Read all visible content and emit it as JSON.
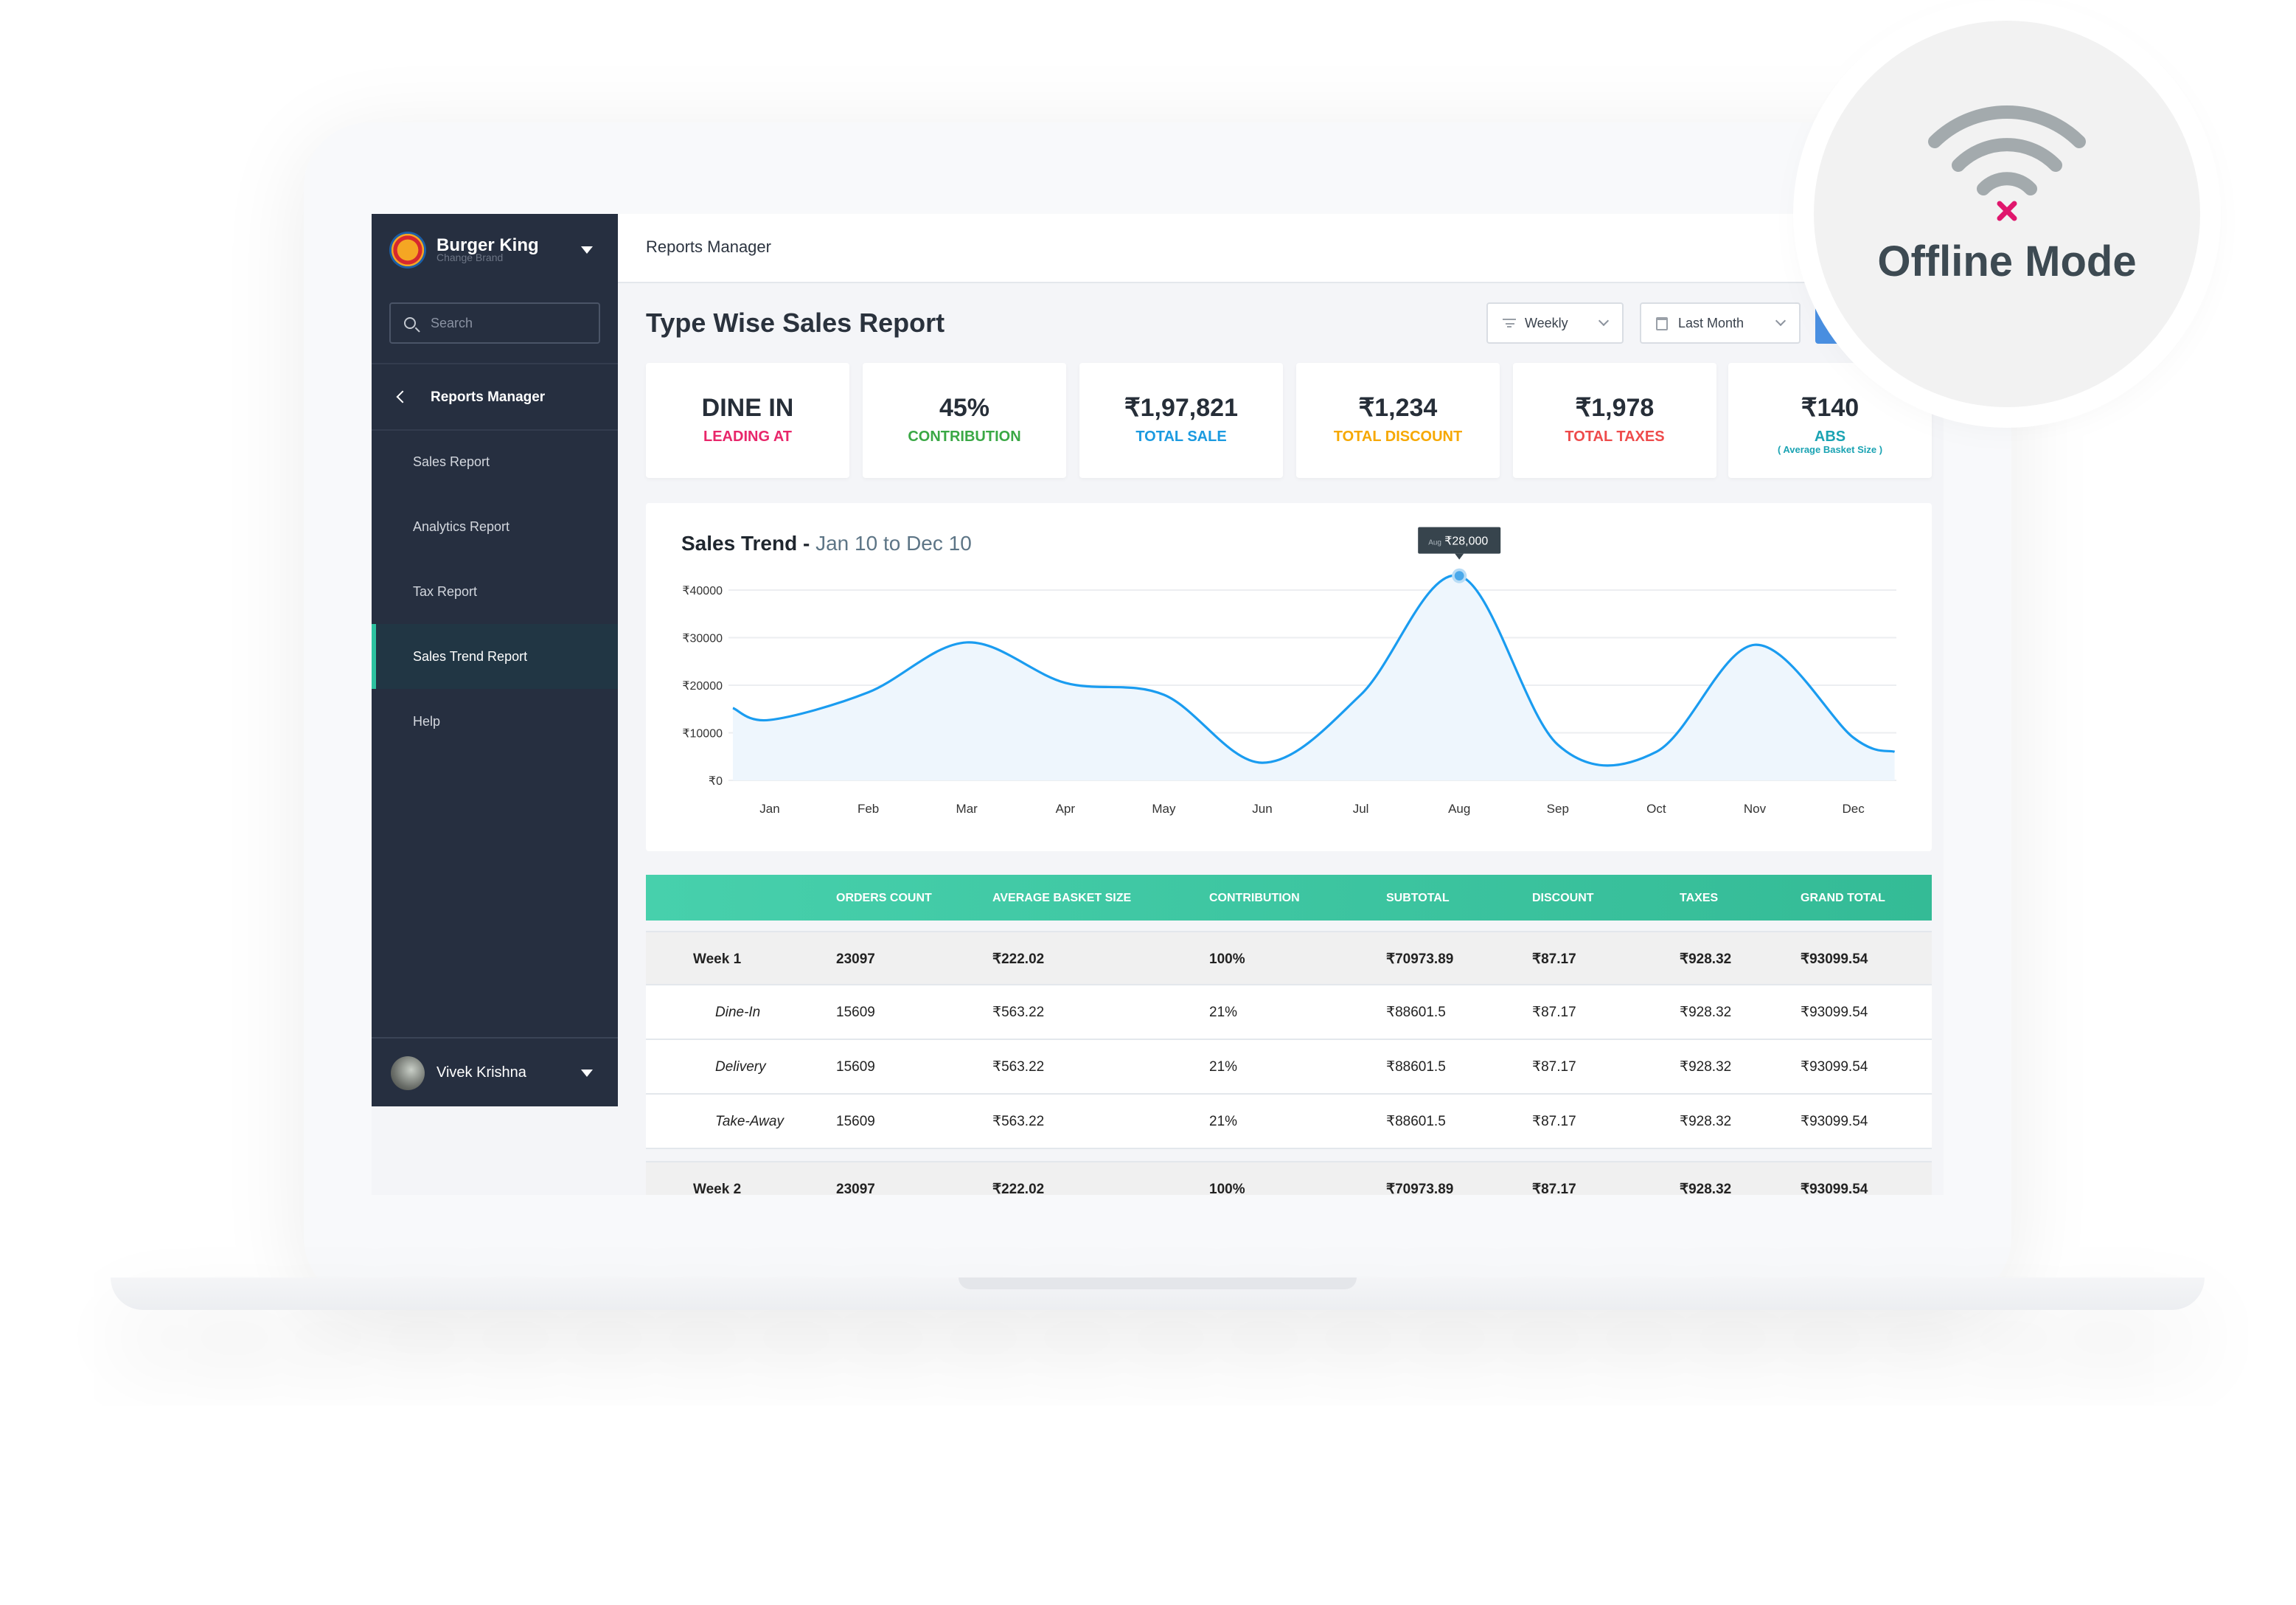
{
  "brand": {
    "name": "Burger King",
    "subtitle": "Change Brand"
  },
  "sidebar": {
    "search_placeholder": "Search",
    "section": "Reports Manager",
    "items": [
      {
        "label": "Sales Report",
        "active": false
      },
      {
        "label": "Analytics Report",
        "active": false
      },
      {
        "label": "Tax Report",
        "active": false
      },
      {
        "label": "Sales Trend Report",
        "active": true
      },
      {
        "label": "Help",
        "active": false
      }
    ],
    "user": "Vivek Krishna"
  },
  "header": {
    "breadcrumb": "Reports Manager"
  },
  "page": {
    "title": "Type Wise Sales Report",
    "period_filter": "Weekly",
    "date_filter": "Last Month"
  },
  "kpis": [
    {
      "value": "DINE IN",
      "label": "LEADING AT",
      "color": "#e8266a"
    },
    {
      "value": "45%",
      "label": "CONTRIBUTION",
      "color": "#3aa845"
    },
    {
      "value": "₹1,97,821",
      "label": "TOTAL SALE",
      "color": "#1a9ae0"
    },
    {
      "value": "₹1,234",
      "label": "TOTAL DISCOUNT",
      "color": "#f6a800"
    },
    {
      "value": "₹1,978",
      "label": "TOTAL TAXES",
      "color": "#ee4b4b"
    },
    {
      "value": "₹140",
      "label": "ABS",
      "sub": "( Average Basket Size )",
      "color": "#1aa3b3"
    }
  ],
  "chart": {
    "title": "Sales Trend",
    "range": "Jan 10 to Dec 10",
    "tooltip_month": "Aug",
    "tooltip_value": "₹28,000"
  },
  "chart_data": {
    "type": "area",
    "categories": [
      "Jan",
      "Feb",
      "Mar",
      "Apr",
      "May",
      "Jun",
      "Jul",
      "Aug",
      "Sep",
      "Oct",
      "Nov",
      "Dec"
    ],
    "values": [
      12700,
      18500,
      29000,
      20500,
      18000,
      3700,
      18000,
      43000,
      7500,
      6000,
      28500,
      9000
    ],
    "yticks": [
      "₹0",
      "₹10000",
      "₹20000",
      "₹30000",
      "₹40000"
    ],
    "ylim": [
      0,
      40000
    ],
    "grid": true,
    "line_color": "#1a9cf0",
    "highlight_category": "Aug"
  },
  "table": {
    "headers": [
      "",
      "ORDERS COUNT",
      "AVERAGE BASKET SIZE",
      "CONTRIBUTION",
      "SUBTOTAL",
      "DISCOUNT",
      "TAXES",
      "GRAND TOTAL"
    ],
    "rows": [
      {
        "type": "week",
        "cells": [
          "Week 1",
          "23097",
          "₹222.02",
          "100%",
          "₹70973.89",
          "₹87.17",
          "₹928.32",
          "₹93099.54"
        ]
      },
      {
        "type": "sub",
        "cells": [
          "Dine-In",
          "15609",
          "₹563.22",
          "21%",
          "₹88601.5",
          "₹87.17",
          "₹928.32",
          "₹93099.54"
        ]
      },
      {
        "type": "sub",
        "cells": [
          "Delivery",
          "15609",
          "₹563.22",
          "21%",
          "₹88601.5",
          "₹87.17",
          "₹928.32",
          "₹93099.54"
        ]
      },
      {
        "type": "sub",
        "cells": [
          "Take-Away",
          "15609",
          "₹563.22",
          "21%",
          "₹88601.5",
          "₹87.17",
          "₹928.32",
          "₹93099.54"
        ]
      },
      {
        "type": "week",
        "cells": [
          "Week 2",
          "23097",
          "₹222.02",
          "100%",
          "₹70973.89",
          "₹87.17",
          "₹928.32",
          "₹93099.54"
        ]
      }
    ]
  },
  "offline": {
    "label": "Offline Mode",
    "icon": "wifi-off-icon"
  }
}
